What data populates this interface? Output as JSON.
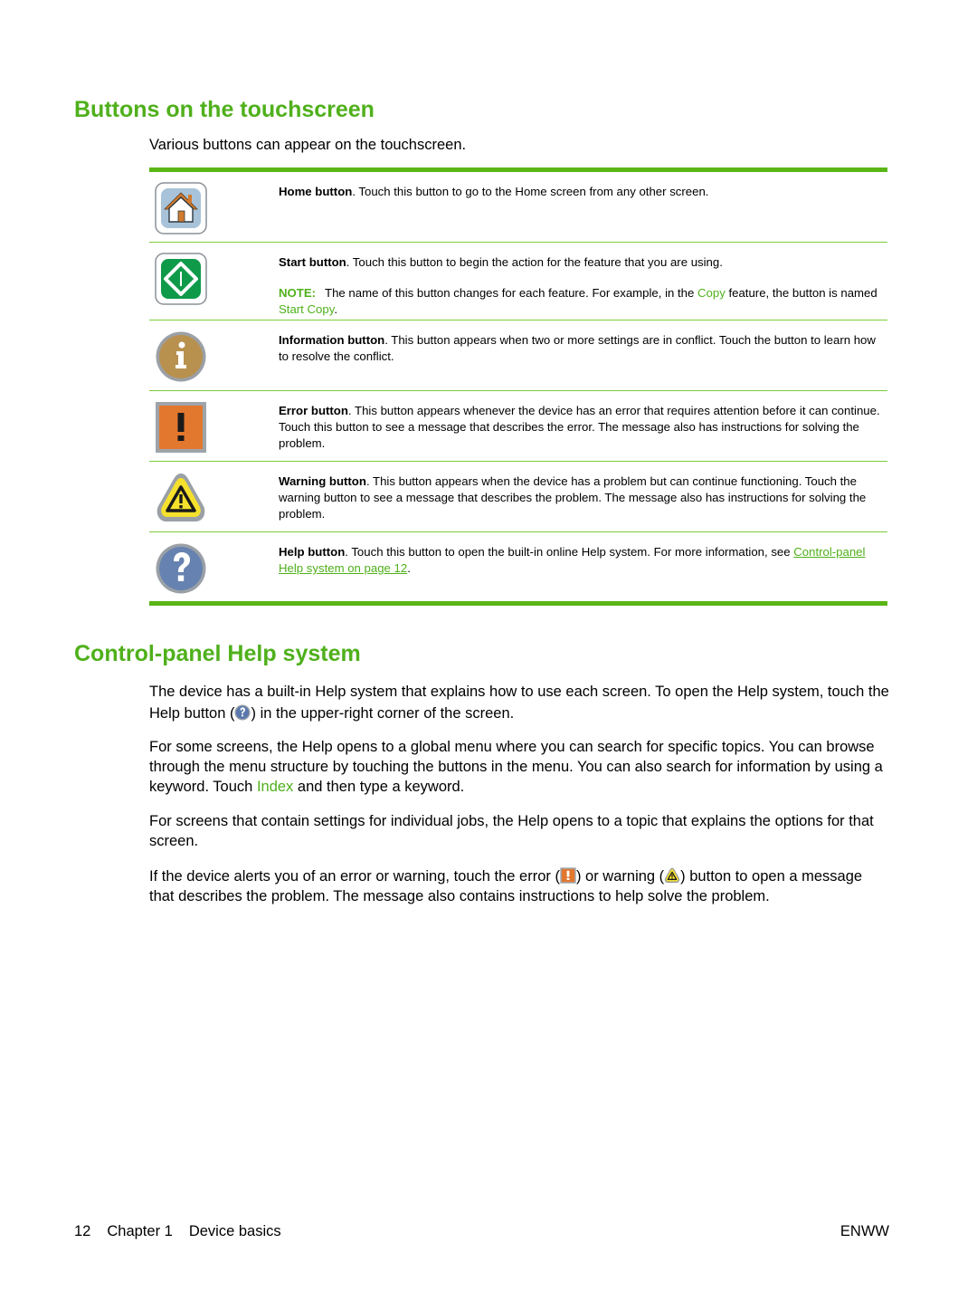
{
  "sections": {
    "buttons": {
      "title": "Buttons on the touchscreen",
      "intro": "Various buttons can appear on the touchscreen.",
      "rows": [
        {
          "icon": "home-icon",
          "name": "Home button",
          "description": ". Touch this button to go to the Home screen from any other screen."
        },
        {
          "icon": "start-icon",
          "name": "Start button",
          "description": ". Touch this button to begin the action for the feature that you are using.",
          "note": {
            "label": "NOTE:",
            "text_1": "The name of this button changes for each feature. For example, in the ",
            "highlight_1": "Copy",
            "text_2": " feature, the button is named ",
            "highlight_2": "Start Copy",
            "text_3": "."
          }
        },
        {
          "icon": "information-icon",
          "name": "Information button",
          "description": ". This button appears when two or more settings are in conflict. Touch the button to learn how to resolve the conflict."
        },
        {
          "icon": "error-icon",
          "name": "Error button",
          "description": ". This button appears whenever the device has an error that requires attention before it can continue. Touch this button to see a message that describes the error. The message also has instructions for solving the problem."
        },
        {
          "icon": "warning-icon",
          "name": "Warning button",
          "description": ". This button appears when the device has a problem but can continue functioning. Touch the warning button to see a message that describes the problem. The message also has instructions for solving the problem."
        },
        {
          "icon": "help-icon",
          "name": "Help button",
          "description": ". Touch this button to open the built-in online Help system. For more information, see ",
          "link": "Control-panel Help system on page 12",
          "description_end": "."
        }
      ]
    },
    "help": {
      "title": "Control-panel Help system",
      "p1_a": "The device has a built-in Help system that explains how to use each screen. To open the Help system, touch the Help button (",
      "p1_b": ") in the upper-right corner of the screen.",
      "p2_a": "For some screens, the Help opens to a global menu where you can search for specific topics. You can browse through the menu structure by touching the buttons in the menu. You can also search for information by using a keyword. Touch ",
      "p2_highlight": "Index",
      "p2_b": " and then type a keyword.",
      "p3": "For screens that contain settings for individual jobs, the Help opens to a topic that explains the options for that screen.",
      "p4_a": "If the device alerts you of an error or warning, touch the error (",
      "p4_b": ") or warning (",
      "p4_c": ") button to open a message that describes the problem. The message also contains instructions to help solve the problem."
    }
  },
  "footer": {
    "page_number": "12",
    "chapter": "Chapter 1",
    "chapter_title": "Device basics",
    "locale": "ENWW"
  },
  "colors": {
    "accent_green": "#4fb01b",
    "rule_green": "#5ab515"
  }
}
